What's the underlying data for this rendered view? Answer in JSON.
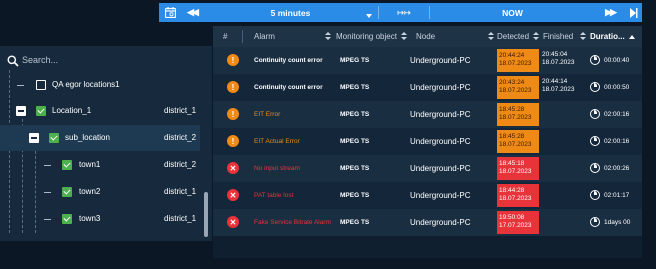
{
  "toolbar": {
    "range": "5 minutes",
    "span_icon": "↦↦",
    "now": "NOW",
    "icons": [
      "calendar-icon",
      "rewind-icon",
      "fast-forward-icon",
      "skip-end-icon"
    ]
  },
  "sidebar": {
    "search_placeholder": "Search...",
    "tree": [
      {
        "label": "QA egor locations1",
        "district": "",
        "checked": false
      },
      {
        "label": "Location_1",
        "district": "district_1",
        "checked": true
      },
      {
        "label": "sub_location",
        "district": "district_2",
        "checked": true
      },
      {
        "label": "town1",
        "district": "district_2",
        "checked": true
      },
      {
        "label": "town2",
        "district": "district_1",
        "checked": true
      },
      {
        "label": "town3",
        "district": "district_1",
        "checked": true
      }
    ]
  },
  "table": {
    "columns": {
      "num": "#",
      "alarm": "Alarm",
      "monitoring": "Monitoring object",
      "node": "Node",
      "detected": "Detected",
      "finished": "Finished",
      "duration": "Duratio..."
    },
    "rows": [
      {
        "severity": "warning",
        "alarm": "Continuity count error",
        "monitoring": "MPEG TS",
        "node": "Underground-PC",
        "detected_time": "20:44:24",
        "detected_date": "18.07.2023",
        "finished_time": "20:45:04",
        "finished_date": "18.07.2023",
        "duration": "00:00:40"
      },
      {
        "severity": "warning",
        "alarm": "Continuity count error",
        "monitoring": "MPEG TS",
        "node": "Underground-PC",
        "detected_time": "20:43:24",
        "detected_date": "18.07.2023",
        "finished_time": "20:44:14",
        "finished_date": "18.07.2023",
        "duration": "00:00:50"
      },
      {
        "severity": "warning",
        "alarm": "EIT Error",
        "monitoring": "MPEG TS",
        "node": "Underground-PC",
        "detected_time": "18:45:28",
        "detected_date": "18.07.2023",
        "finished_time": "",
        "finished_date": "",
        "duration": "02:00:16"
      },
      {
        "severity": "warning",
        "alarm": "EIT Actual Error",
        "monitoring": "MPEG TS",
        "node": "Underground-PC",
        "detected_time": "18:45:28",
        "detected_date": "18.07.2023",
        "finished_time": "",
        "finished_date": "",
        "duration": "02:00:16"
      },
      {
        "severity": "critical",
        "alarm": "No input stream",
        "monitoring": "MPEG TS",
        "node": "Underground-PC",
        "detected_time": "18:45:18",
        "detected_date": "18.07.2023",
        "finished_time": "",
        "finished_date": "",
        "duration": "02:00:26"
      },
      {
        "severity": "critical",
        "alarm": "PAT table lost",
        "monitoring": "MPEG TS",
        "node": "Underground-PC",
        "detected_time": "18:44:28",
        "detected_date": "18.07.2023",
        "finished_time": "",
        "finished_date": "",
        "duration": "02:01:17"
      },
      {
        "severity": "critical",
        "alarm": "Fake Service Bitrate Alarm",
        "monitoring": "MPEG TS",
        "node": "Underground-PC",
        "detected_time": "19:50:08",
        "detected_date": "17.07.2023",
        "finished_time": "",
        "finished_date": "",
        "duration": "1days 00"
      }
    ]
  },
  "colors": {
    "toolbar": "#2b8ce8",
    "warning": "#f08a16",
    "critical": "#e8333b",
    "checkbox": "#4caf50",
    "background": "#0c1726"
  }
}
